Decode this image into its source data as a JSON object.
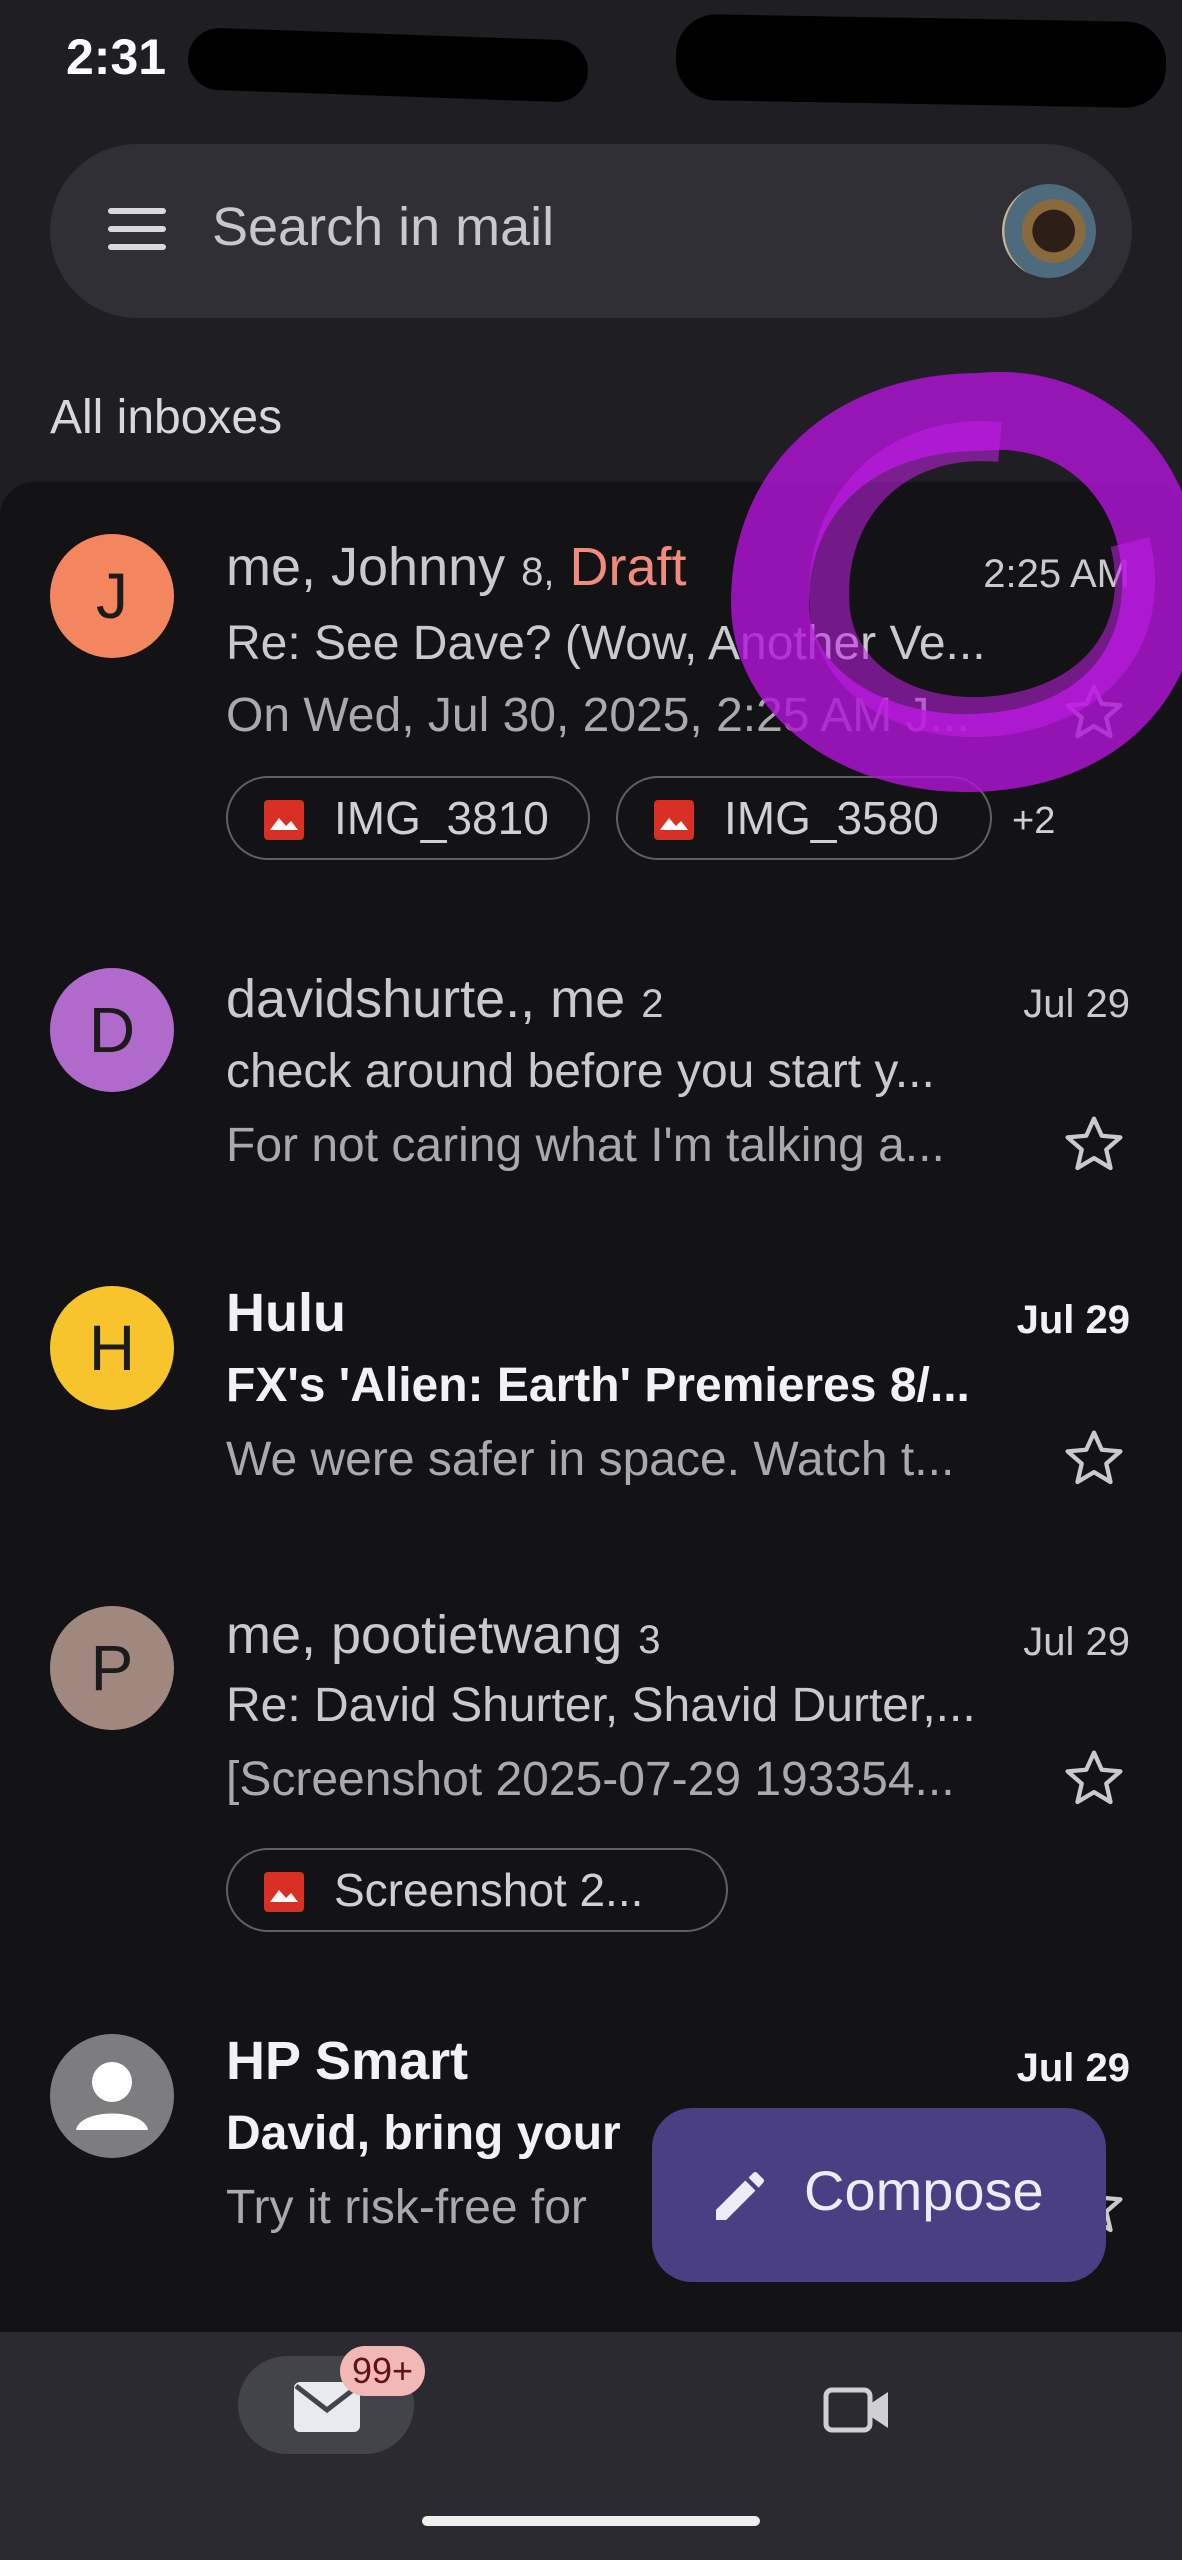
{
  "status_bar": {
    "time": "2:31"
  },
  "search": {
    "placeholder": "Search in mail"
  },
  "section_label": "All inboxes",
  "emails": [
    {
      "avatar_letter": "J",
      "avatar_color": "#f4865f",
      "sender": "me, Johnny",
      "count": "8,",
      "draft": "Draft",
      "date": "2:25 AM",
      "subject": "Re: See Dave? (Wow, Another Ve...",
      "snippet": "On Wed, Jul 30, 2025, 2:25 AM J...",
      "attachments": [
        "IMG_3810",
        "IMG_3580"
      ],
      "more_attachments": "+2",
      "unread": false
    },
    {
      "avatar_letter": "D",
      "avatar_color": "#b06acb",
      "sender": "davidshurte., me",
      "count": "2",
      "date": "Jul 29",
      "subject": "check around before you start y...",
      "snippet": "For not caring what I'm talking a...",
      "unread": false
    },
    {
      "avatar_letter": "H",
      "avatar_color": "#f7c42e",
      "sender": "Hulu",
      "date": "Jul 29",
      "subject": "FX's 'Alien: Earth' Premieres 8/...",
      "snippet": "We were safer in space. Watch t...",
      "unread": true
    },
    {
      "avatar_letter": "P",
      "avatar_color": "#a1887f",
      "sender": "me, pootietwang",
      "count": "3",
      "date": "Jul 29",
      "subject": "Re: David Shurter, Shavid Durter,...",
      "snippet": "[Screenshot 2025-07-29 193354...",
      "attachments": [
        "Screenshot 2..."
      ],
      "unread": false
    },
    {
      "avatar_color": "#7d7d80",
      "sender": "HP Smart",
      "date": "Jul 29",
      "subject": "David, bring your",
      "snippet": "Try it risk-free for",
      "unread": true
    }
  ],
  "compose": {
    "label": "Compose"
  },
  "bottom_nav": {
    "mail_badge": "99+"
  }
}
